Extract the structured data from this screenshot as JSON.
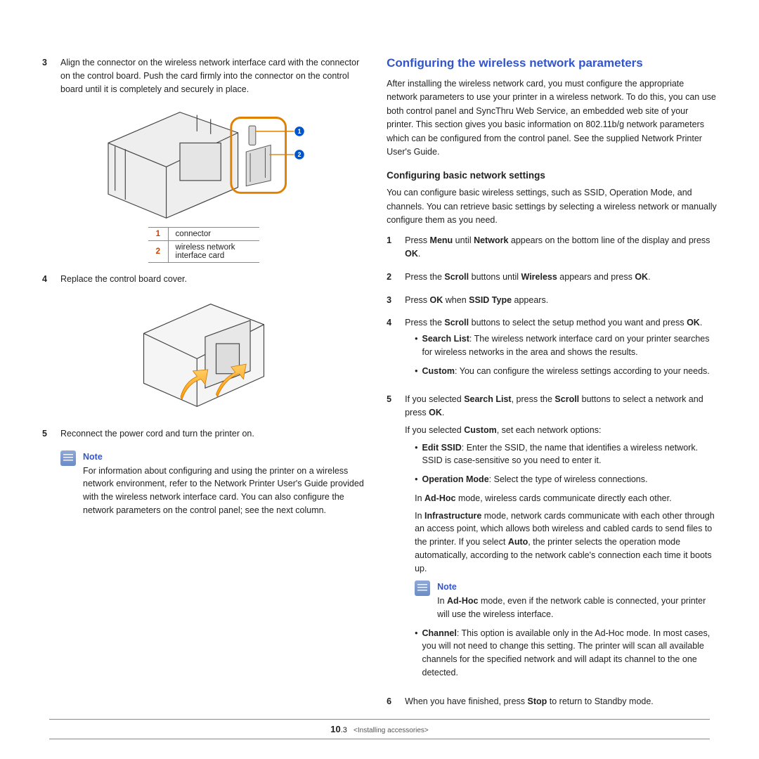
{
  "left": {
    "steps": [
      {
        "n": "3",
        "text": "Align the connector on the wireless network interface card with the connector on the control board. Push the card firmly into the connector on the control board until it is completely and securely in place."
      },
      {
        "n": "4",
        "text": "Replace the control board cover."
      },
      {
        "n": "5",
        "text": "Reconnect the power cord and turn the printer on."
      }
    ],
    "legend": [
      {
        "n": "1",
        "label": "connector"
      },
      {
        "n": "2",
        "label": "wireless network interface card"
      }
    ],
    "note": {
      "title": "Note",
      "text": "For information about configuring and using the printer on a wireless network environment, refer to the Network Printer User's Guide provided with the wireless network interface card. You can also configure the network parameters on the control panel; see the next column."
    }
  },
  "right": {
    "h2": "Configuring the wireless network parameters",
    "intro": "After installing the wireless network card, you must configure the appropriate network parameters to use your printer in a wireless network. To do this, you can use both control panel and SyncThru Web Service, an embedded web site of your printer. This section gives you basic information on 802.11b/g network parameters which can be configured from the control panel. See the supplied Network Printer User's Guide.",
    "h3": "Configuring basic network settings",
    "sub_intro": "You can configure basic wireless settings, such as SSID, Operation Mode, and channels. You can retrieve basic settings by selecting a wireless network or manually configure them as you need.",
    "s1_a": "Press ",
    "s1_b": "Menu",
    "s1_c": " until ",
    "s1_d": "Network",
    "s1_e": " appears on the bottom line of the display and press ",
    "s1_f": "OK",
    "s1_g": ".",
    "s2_a": "Press the ",
    "s2_b": "Scroll",
    "s2_c": " buttons until ",
    "s2_d": "Wireless",
    "s2_e": " appears and press ",
    "s2_f": "OK",
    "s2_g": ".",
    "s3_a": "Press ",
    "s3_b": "OK",
    "s3_c": " when ",
    "s3_d": "SSID Type",
    "s3_e": " appears.",
    "s4_a": "Press the ",
    "s4_b": "Scroll",
    "s4_c": " buttons to select the setup method you want and press ",
    "s4_d": "OK",
    "s4_e": ".",
    "s4_bul1_a": "Search List",
    "s4_bul1_b": ": The wireless network interface card on your printer searches for wireless networks in the area and shows the results.",
    "s4_bul2_a": "Custom",
    "s4_bul2_b": ": You can configure the wireless settings according to your needs.",
    "s5_a": "If you selected ",
    "s5_b": "Search List",
    "s5_c": ", press the ",
    "s5_d": "Scroll",
    "s5_e": " buttons to select a network and press ",
    "s5_f": "OK",
    "s5_g": ".",
    "s5_p_a": "If you selected ",
    "s5_p_b": "Custom",
    "s5_p_c": ", set each network options:",
    "s5_bul1_a": "Edit SSID",
    "s5_bul1_b": ": Enter the SSID, the name that identifies a wireless network. SSID is case-sensitive so you need to enter it.",
    "s5_bul2_a": "Operation Mode",
    "s5_bul2_b": ": Select the type of wireless connections.",
    "s5_p2_a": "In ",
    "s5_p2_b": "Ad-Hoc",
    "s5_p2_c": " mode, wireless cards communicate directly each other.",
    "s5_p3_a": "In ",
    "s5_p3_b": "Infrastructure",
    "s5_p3_c": " mode, network cards communicate with each other through an access point, which allows both wireless and cabled cards to send files to the printer. If you select ",
    "s5_p3_d": "Auto",
    "s5_p3_e": ", the printer selects the operation mode automatically, according to the network cable's connection each time it boots up.",
    "s5_note_title": "Note",
    "s5_note_a": "In ",
    "s5_note_b": "Ad-Hoc",
    "s5_note_c": " mode, even if the network cable is connected, your printer will use the wireless interface.",
    "s5_bul3_a": "Channel",
    "s5_bul3_b": ": This option is available only in the Ad-Hoc mode. In most cases, you will not need to change this setting. The printer will scan all available channels for the specified network and will adapt its channel to the one detected.",
    "s6_a": "When you have finished, press ",
    "s6_b": "Stop",
    "s6_c": " to return to Standby mode."
  },
  "footer": {
    "page": "10",
    "sub": ".3",
    "section": "<Installing accessories>"
  }
}
